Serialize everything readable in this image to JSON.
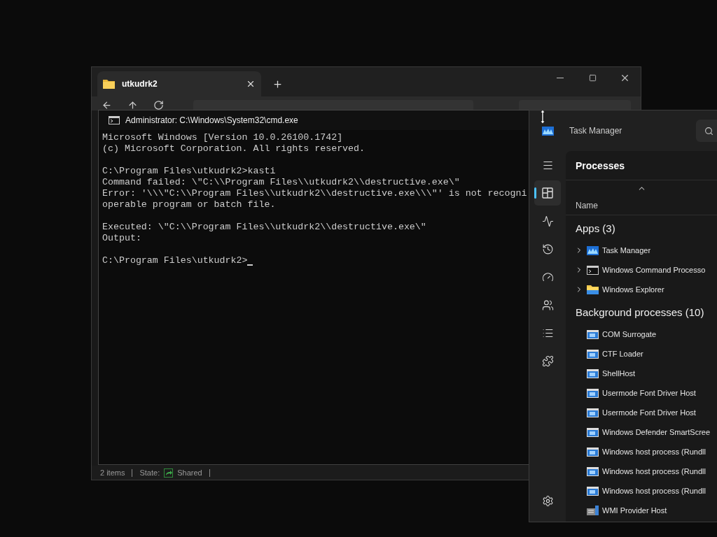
{
  "explorer": {
    "tab": {
      "title": "utkudrk2"
    },
    "status_bar": {
      "items": "2 items",
      "state_label": "State:",
      "state": "Shared"
    }
  },
  "cmd": {
    "title": "Administrator: C:\\Windows\\System32\\cmd.exe",
    "blocks": [
      {
        "lines": [
          "Microsoft Windows [Version 10.0.26100.1742]",
          "(c) Microsoft Corporation. All rights reserved."
        ]
      },
      {
        "lines": [
          "C:\\Program Files\\utkudrk2>kasti",
          "Command failed: \\\"C:\\\\Program Files\\\\utkudrk2\\\\destructive.exe\\\"",
          "Error: '\\\\\\\"C:\\\\Program Files\\\\utkudrk2\\\\destructive.exe\\\\\\\"' is not recogni",
          "operable program or batch file."
        ]
      },
      {
        "lines": [
          "Executed: \\\"C:\\\\Program Files\\\\utkudrk2\\\\destructive.exe\\\"",
          "Output:"
        ]
      },
      {
        "lines": [
          "C:\\Program Files\\utkudrk2>"
        ]
      }
    ]
  },
  "task_manager": {
    "title": "Task Manager",
    "nav": [
      {
        "kind": "menu",
        "selected": false
      },
      {
        "kind": "processes",
        "selected": true
      },
      {
        "kind": "performance",
        "selected": false
      },
      {
        "kind": "history",
        "selected": false
      },
      {
        "kind": "startup",
        "selected": false
      },
      {
        "kind": "users",
        "selected": false
      },
      {
        "kind": "details",
        "selected": false
      },
      {
        "kind": "services",
        "selected": false
      },
      {
        "kind": "settings",
        "selected": false
      }
    ],
    "page_title": "Processes",
    "column": "Name",
    "groups": [
      {
        "title": "Apps (3)",
        "rows": [
          {
            "name": "Task Manager",
            "kind": "taskmanager",
            "expandable": true
          },
          {
            "name": "Windows Command Processo",
            "kind": "cmd",
            "expandable": true
          },
          {
            "name": "Windows Explorer",
            "kind": "explorer",
            "expandable": true
          }
        ]
      },
      {
        "title": "Background processes (10)",
        "rows": [
          {
            "name": "COM Surrogate",
            "kind": "service",
            "expandable": false
          },
          {
            "name": "CTF Loader",
            "kind": "service",
            "expandable": false
          },
          {
            "name": "ShellHost",
            "kind": "service",
            "expandable": false
          },
          {
            "name": "Usermode Font Driver Host",
            "kind": "service",
            "expandable": false
          },
          {
            "name": "Usermode Font Driver Host",
            "kind": "service",
            "expandable": false
          },
          {
            "name": "Windows Defender SmartScree",
            "kind": "service",
            "expandable": false
          },
          {
            "name": "Windows host process (Rundll",
            "kind": "service",
            "expandable": false
          },
          {
            "name": "Windows host process (Rundll",
            "kind": "service",
            "expandable": false
          },
          {
            "name": "Windows host process (Rundll",
            "kind": "service",
            "expandable": false
          },
          {
            "name": "WMI Provider Host",
            "kind": "wmi",
            "expandable": false
          }
        ]
      }
    ]
  }
}
